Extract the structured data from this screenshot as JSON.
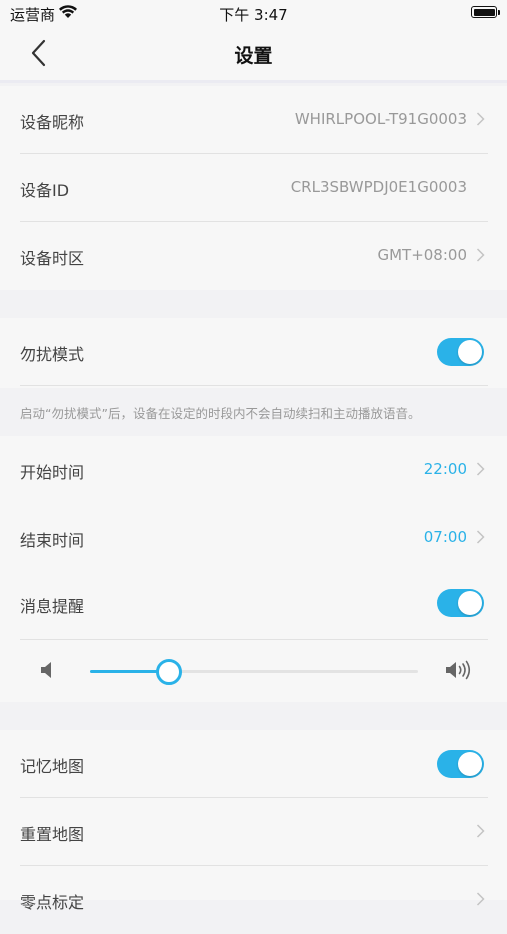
{
  "status_bar": {
    "carrier": "运营商",
    "time": "下午 3:47"
  },
  "nav": {
    "title": "设置"
  },
  "device": {
    "nickname_label": "设备昵称",
    "nickname_value": "WHIRLPOOL-T91G0003",
    "id_label": "设备ID",
    "id_value": "CRL3SBWPDJ0E1G0003",
    "timezone_label": "设备时区",
    "timezone_value": "GMT+08:00"
  },
  "dnd": {
    "label": "勿扰模式",
    "enabled": true,
    "note": "启动“勿扰模式”后，设备在设定的时段内不会自动续扫和主动播放语音。",
    "start_label": "开始时间",
    "start_value": "22:00",
    "end_label": "结束时间",
    "end_value": "07:00",
    "message_label": "消息提醒",
    "message_enabled": true,
    "volume_level": 0.24
  },
  "map": {
    "memory_label": "记忆地图",
    "memory_enabled": true,
    "reset_label": "重置地图",
    "calibrate_label": "零点标定"
  },
  "colors": {
    "accent": "#2ab2e8",
    "background": "#f2f2f4",
    "row_bg": "#f7f7f7"
  }
}
